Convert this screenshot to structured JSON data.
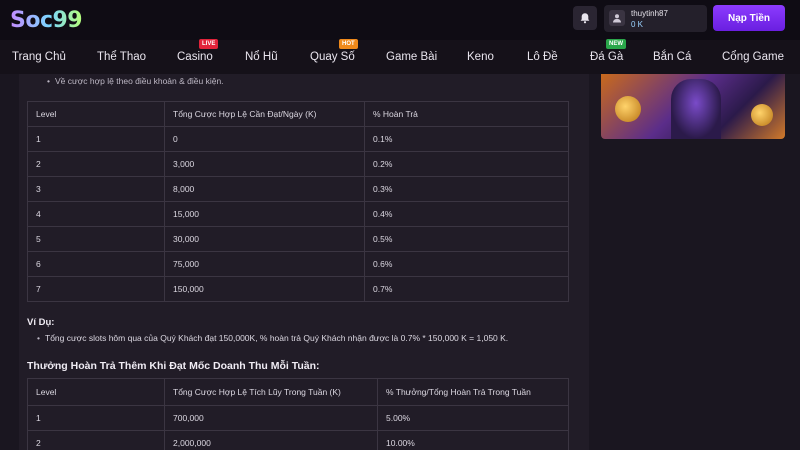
{
  "header": {
    "logo": "Soc99",
    "username": "thuytinh87",
    "balance": "0 K",
    "deposit_label": "Nạp Tiền"
  },
  "nav": {
    "items": [
      {
        "label": "Trang Chủ"
      },
      {
        "label": "Thể Thao"
      },
      {
        "label": "Casino",
        "badge": "LIVE"
      },
      {
        "label": "Nổ Hũ"
      },
      {
        "label": "Quay Số",
        "badge": "HOT"
      },
      {
        "label": "Game Bài"
      },
      {
        "label": "Keno"
      },
      {
        "label": "Lô Đề"
      },
      {
        "label": "Đá Gà",
        "badge": "NEW"
      },
      {
        "label": "Bắn Cá"
      },
      {
        "label": "Cổng Game"
      }
    ]
  },
  "content": {
    "note": "Về cược hợp lệ theo điều khoản & điều kiện.",
    "table1": {
      "headers": [
        "Level",
        "Tổng Cược Hợp Lệ Cần Đạt/Ngày (K)",
        "% Hoàn Trả"
      ],
      "rows": [
        [
          "1",
          "0",
          "0.1%"
        ],
        [
          "2",
          "3,000",
          "0.2%"
        ],
        [
          "3",
          "8,000",
          "0.3%"
        ],
        [
          "4",
          "15,000",
          "0.4%"
        ],
        [
          "5",
          "30,000",
          "0.5%"
        ],
        [
          "6",
          "75,000",
          "0.6%"
        ],
        [
          "7",
          "150,000",
          "0.7%"
        ]
      ]
    },
    "example_title": "Ví Dụ:",
    "example_text": "Tổng cược slots hôm qua của Quý Khách đạt 150,000K, % hoàn trả Quý Khách nhận được là 0.7% * 150,000 K = 1,050 K.",
    "weekly_title": "Thưởng Hoàn Trả Thêm Khi Đạt Mốc Doanh Thu Mỗi Tuần:",
    "table2": {
      "headers": [
        "Level",
        "Tổng Cược Hợp Lệ Tích Lũy Trong Tuần (K)",
        "% Thưởng/Tổng Hoàn Trả Trong Tuần"
      ],
      "rows": [
        [
          "1",
          "700,000",
          "5.00%"
        ],
        [
          "2",
          "2,000,000",
          "10.00%"
        ]
      ]
    }
  },
  "colors": {
    "accent": "#7b2ff0",
    "background": "#1a1620",
    "panel": "#211c27"
  }
}
